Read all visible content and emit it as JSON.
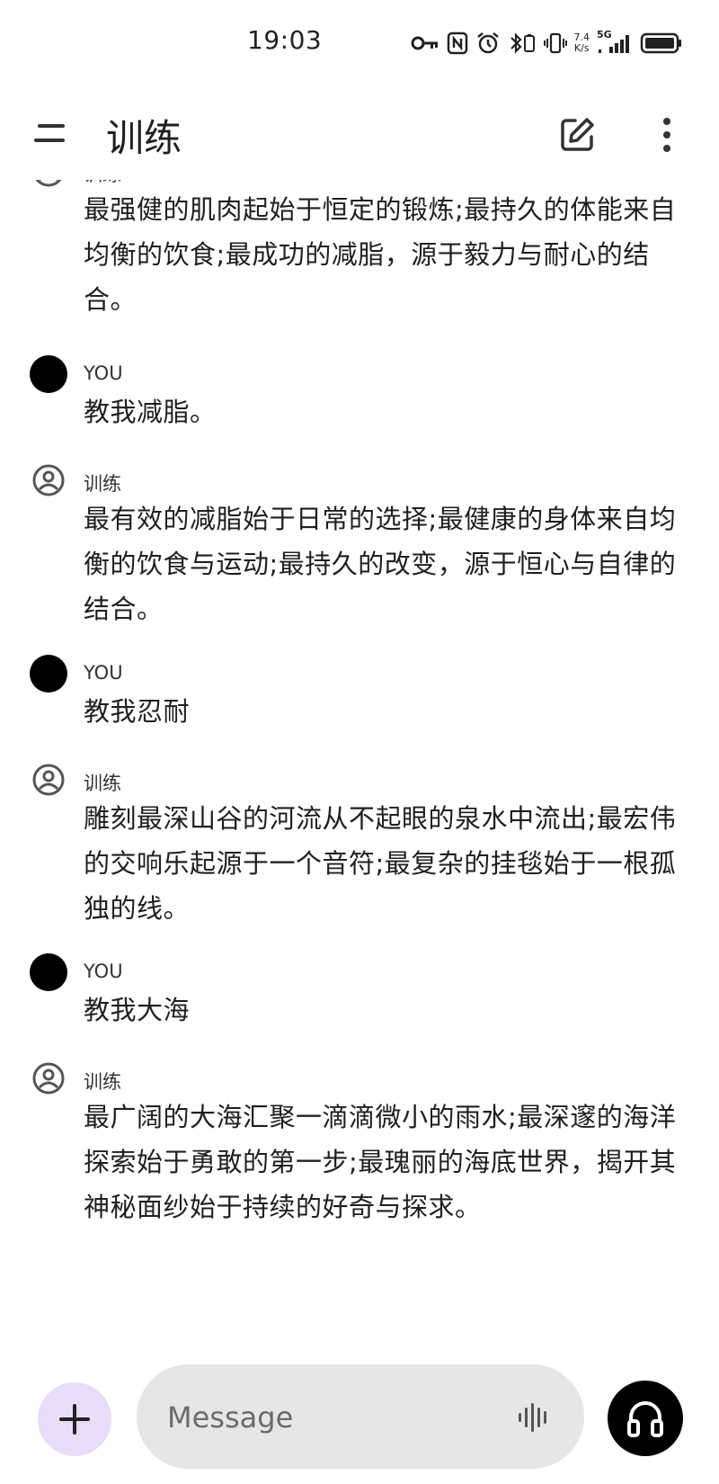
{
  "status_bar": {
    "time": "19:03",
    "speed_value": "7.4",
    "speed_unit": "K/s",
    "network": "5G",
    "icons": [
      "key-icon",
      "nfc-icon",
      "alarm-icon",
      "bluetooth-icon",
      "vibrate-icon",
      "signal-icon",
      "battery-icon"
    ]
  },
  "app_bar": {
    "title": "训练",
    "icons": [
      "menu-icon",
      "edit-icon",
      "more-vert-icon"
    ]
  },
  "messages": [
    {
      "sender": "训练",
      "role": "assistant",
      "text": "最强健的肌肉起始于恒定的锻炼;最持久的体能来自均衡的饮食;最成功的减脂，源于毅力与耐心的结合。"
    },
    {
      "sender": "YOU",
      "role": "user",
      "text": "教我减脂。"
    },
    {
      "sender": "训练",
      "role": "assistant",
      "text": "最有效的减脂始于日常的选择;最健康的身体来自均衡的饮食与运动;最持久的改变，源于恒心与自律的结合。"
    },
    {
      "sender": "YOU",
      "role": "user",
      "text": "教我忍耐"
    },
    {
      "sender": "训练",
      "role": "assistant",
      "text": "雕刻最深山谷的河流从不起眼的泉水中流出;最宏伟的交响乐起源于一个音符;最复杂的挂毯始于一根孤独的线。"
    },
    {
      "sender": "YOU",
      "role": "user",
      "text": "教我大海"
    },
    {
      "sender": "训练",
      "role": "assistant",
      "text": "最广阔的大海汇聚一滴滴微小的雨水;最深邃的海洋探索始于勇敢的第一步;最瑰丽的海底世界，揭开其神秘面纱始于持续的好奇与探求。"
    }
  ],
  "composer": {
    "placeholder": "Message",
    "icons": [
      "plus-icon",
      "voice-wave-icon",
      "headphones-icon"
    ]
  },
  "colors": {
    "add_button_bg": "#e8dcf8",
    "field_bg": "#e6e6e6",
    "avatar_user": "#000000"
  }
}
